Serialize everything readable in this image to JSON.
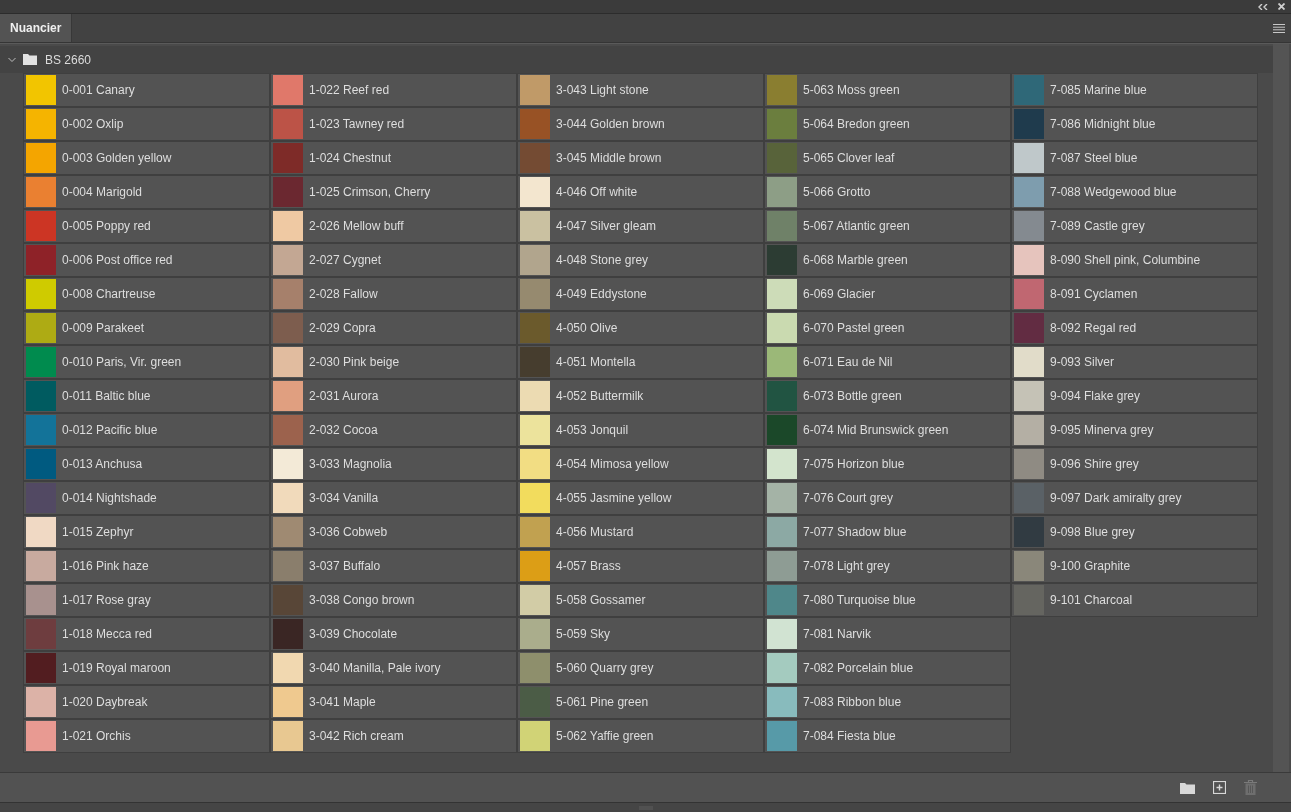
{
  "panel": {
    "tabs": [
      {
        "label": "Nuancier",
        "selected": true
      }
    ]
  },
  "group": {
    "name": "BS 2660",
    "expanded": true
  },
  "swatches": [
    {
      "name": "0-001 Canary",
      "color": "#f2c500"
    },
    {
      "name": "0-002 Oxlip",
      "color": "#f5b400"
    },
    {
      "name": "0-003 Golden yellow",
      "color": "#f4a500"
    },
    {
      "name": "0-004 Marigold",
      "color": "#ea8031"
    },
    {
      "name": "0-005 Poppy red",
      "color": "#cc3524"
    },
    {
      "name": "0-006 Post office red",
      "color": "#8e2228"
    },
    {
      "name": "0-008 Chartreuse",
      "color": "#cfcb00"
    },
    {
      "name": "0-009 Parakeet",
      "color": "#aeab14"
    },
    {
      "name": "0-010 Paris, Vir. green",
      "color": "#008b4e"
    },
    {
      "name": "0-011 Baltic blue",
      "color": "#005b60"
    },
    {
      "name": "0-012 Pacific blue",
      "color": "#137399"
    },
    {
      "name": "0-013 Anchusa",
      "color": "#005a80"
    },
    {
      "name": "0-014 Nightshade",
      "color": "#524963"
    },
    {
      "name": "1-015 Zephyr",
      "color": "#f0d9c4"
    },
    {
      "name": "1-016 Pink haze",
      "color": "#c8aa9f"
    },
    {
      "name": "1-017 Rose gray",
      "color": "#a8918e"
    },
    {
      "name": "1-018 Mecca red",
      "color": "#6e3d3f"
    },
    {
      "name": "1-019 Royal maroon",
      "color": "#521d20"
    },
    {
      "name": "1-020 Daybreak",
      "color": "#dcb2a7"
    },
    {
      "name": "1-021 Orchis",
      "color": "#e89a92"
    },
    {
      "name": "1-022 Reef red",
      "color": "#e0786a"
    },
    {
      "name": "1-023 Tawney red",
      "color": "#bc5347"
    },
    {
      "name": "1-024 Chestnut",
      "color": "#7e2b28"
    },
    {
      "name": "1-025 Crimson, Cherry",
      "color": "#6b2830"
    },
    {
      "name": "2-026 Mellow buff",
      "color": "#efc9a3"
    },
    {
      "name": "2-027 Cygnet",
      "color": "#c3a793"
    },
    {
      "name": "2-028 Fallow",
      "color": "#a6806b"
    },
    {
      "name": "2-029 Copra",
      "color": "#7d5d4e"
    },
    {
      "name": "2-030 Pink beige",
      "color": "#e1bc9f"
    },
    {
      "name": "2-031 Aurora",
      "color": "#e09f80"
    },
    {
      "name": "2-032 Cocoa",
      "color": "#9c624d"
    },
    {
      "name": "3-033 Magnolia",
      "color": "#f3ead7"
    },
    {
      "name": "3-034 Vanilla",
      "color": "#f1dabb"
    },
    {
      "name": "3-036 Cobweb",
      "color": "#9f8a72"
    },
    {
      "name": "3-037 Buffalo",
      "color": "#8a7e6c"
    },
    {
      "name": "3-038 Congo brown",
      "color": "#584637"
    },
    {
      "name": "3-039 Chocolate",
      "color": "#3a2624"
    },
    {
      "name": "3-040 Manilla, Pale ivory",
      "color": "#f1d8b0"
    },
    {
      "name": "3-041 Maple",
      "color": "#efc98f"
    },
    {
      "name": "3-042 Rich cream",
      "color": "#e8c891"
    },
    {
      "name": "3-043 Light stone",
      "color": "#c09a68"
    },
    {
      "name": "3-044 Golden brown",
      "color": "#985225"
    },
    {
      "name": "3-045 Middle brown",
      "color": "#744b33"
    },
    {
      "name": "4-046 Off white",
      "color": "#f3e6cf"
    },
    {
      "name": "4-047 Silver gleam",
      "color": "#cac1a1"
    },
    {
      "name": "4-048 Stone grey",
      "color": "#b1a58d"
    },
    {
      "name": "4-049 Eddystone",
      "color": "#968a6f"
    },
    {
      "name": "4-050 Olive",
      "color": "#6b5a2c"
    },
    {
      "name": "4-051 Montella",
      "color": "#463d2e"
    },
    {
      "name": "4-052 Buttermilk",
      "color": "#ecdbb2"
    },
    {
      "name": "4-053 Jonquil",
      "color": "#ece39c"
    },
    {
      "name": "4-054 Mimosa yellow",
      "color": "#f2dd83"
    },
    {
      "name": "4-055 Jasmine yellow",
      "color": "#f2dc5d"
    },
    {
      "name": "4-056 Mustard",
      "color": "#c1a150"
    },
    {
      "name": "4-057 Brass",
      "color": "#dc9e16"
    },
    {
      "name": "5-058 Gossamer",
      "color": "#d2cca6"
    },
    {
      "name": "5-059 Sky",
      "color": "#aaad8c"
    },
    {
      "name": "5-060 Quarry grey",
      "color": "#8e8f6c"
    },
    {
      "name": "5-061 Pine green",
      "color": "#4b5c46"
    },
    {
      "name": "5-062 Yaffie green",
      "color": "#d1d376"
    },
    {
      "name": "5-063 Moss green",
      "color": "#8a7e30"
    },
    {
      "name": "5-064 Bredon green",
      "color": "#6b7e3e"
    },
    {
      "name": "5-065 Clover leaf",
      "color": "#58633a"
    },
    {
      "name": "5-066 Grotto",
      "color": "#8d9e86"
    },
    {
      "name": "5-067 Atlantic green",
      "color": "#6f8168"
    },
    {
      "name": "6-068 Marble green",
      "color": "#2c3c33"
    },
    {
      "name": "6-069 Glacier",
      "color": "#cddcb8"
    },
    {
      "name": "6-070 Pastel green",
      "color": "#cadab0"
    },
    {
      "name": "6-071 Eau de Nil",
      "color": "#9bb878"
    },
    {
      "name": "6-073 Bottle green",
      "color": "#215442"
    },
    {
      "name": "6-074 Mid Brunswick green",
      "color": "#1b4829"
    },
    {
      "name": "7-075 Horizon blue",
      "color": "#d3e4cd"
    },
    {
      "name": "7-076 Court grey",
      "color": "#a4b3a6"
    },
    {
      "name": "7-077 Shadow blue",
      "color": "#8ca9a4"
    },
    {
      "name": "7-078 Light grey",
      "color": "#8e9c94"
    },
    {
      "name": "7-080 Turquoise blue",
      "color": "#4f878a"
    },
    {
      "name": "7-081 Narvik",
      "color": "#d1e3d2"
    },
    {
      "name": "7-082 Porcelain blue",
      "color": "#a4cbbf"
    },
    {
      "name": "7-083 Ribbon blue",
      "color": "#88bbbd"
    },
    {
      "name": "7-084 Fiesta blue",
      "color": "#579aa8"
    },
    {
      "name": "7-085 Marine blue",
      "color": "#2f6878"
    },
    {
      "name": "7-086 Midnight blue",
      "color": "#1f3b4d"
    },
    {
      "name": "7-087 Steel blue",
      "color": "#bfc8ca"
    },
    {
      "name": "7-088 Wedgewood blue",
      "color": "#7e9dae"
    },
    {
      "name": "7-089 Castle grey",
      "color": "#848a90"
    },
    {
      "name": "8-090 Shell pink, Columbine",
      "color": "#e6c4bd"
    },
    {
      "name": "8-091 Cyclamen",
      "color": "#c06771"
    },
    {
      "name": "8-092 Regal red",
      "color": "#622c42"
    },
    {
      "name": "9-093 Silver",
      "color": "#e1dcc9"
    },
    {
      "name": "9-094 Flake grey",
      "color": "#c5c2b6"
    },
    {
      "name": "9-095 Minerva grey",
      "color": "#b4afa4"
    },
    {
      "name": "9-096 Shire grey",
      "color": "#8f8b83"
    },
    {
      "name": "9-097 Dark amiralty grey",
      "color": "#5a6166"
    },
    {
      "name": "9-098 Blue grey",
      "color": "#313b42"
    },
    {
      "name": "9-100 Graphite",
      "color": "#8a877a"
    },
    {
      "name": "9-101 Charcoal",
      "color": "#656560"
    }
  ]
}
